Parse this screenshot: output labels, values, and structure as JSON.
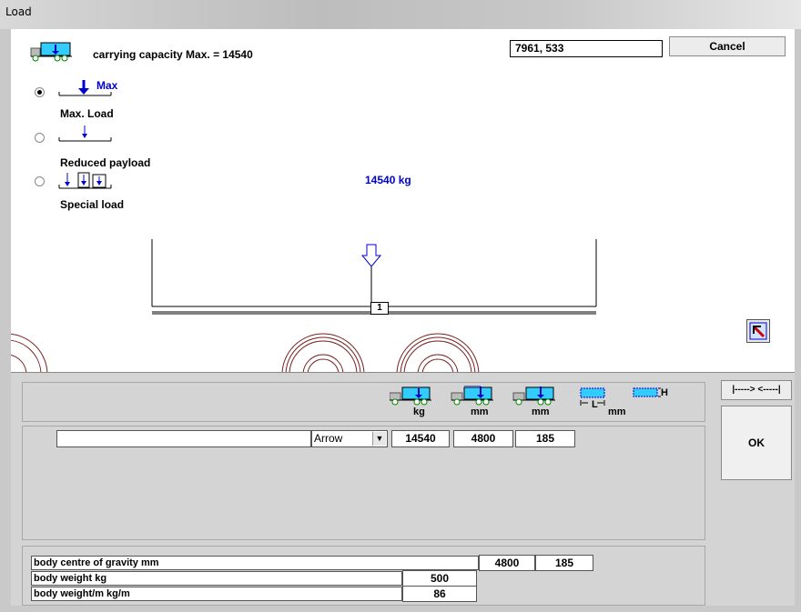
{
  "window": {
    "title": "Load"
  },
  "header": {
    "capacity_label": "carrying capacity Max.  =  14540",
    "coord_value": "7961, 533",
    "cancel_label": "Cancel"
  },
  "load_options": {
    "max_tag": "Max",
    "max_label": "Max. Load",
    "reduced_label": "Reduced payload",
    "special_label": "Special load",
    "selected": "max"
  },
  "load_value": "14540 kg",
  "diagram": {
    "marker_number": "1"
  },
  "toolbar": {
    "col_units": [
      "kg",
      "mm",
      "mm",
      "mm"
    ],
    "height_tag": "H",
    "length_tag": "L"
  },
  "right_panel": {
    "align_label": "|-----> <-----|",
    "ok_label": "OK"
  },
  "load_row": {
    "name": "",
    "type": "Arrow",
    "weight": "14540",
    "x": "4800",
    "y": "185"
  },
  "body": {
    "cog_label": "body centre of gravity   mm",
    "cog_x": "4800",
    "cog_y": "185",
    "weight_label": "body weight   kg",
    "weight_value": "500",
    "weight_per_m_label": "body weight/m    kg/m",
    "weight_per_m_value": "86"
  },
  "colors": {
    "accent": "#0000cc",
    "wheel": "#7a1f1f",
    "cyan": "#33ccff"
  }
}
